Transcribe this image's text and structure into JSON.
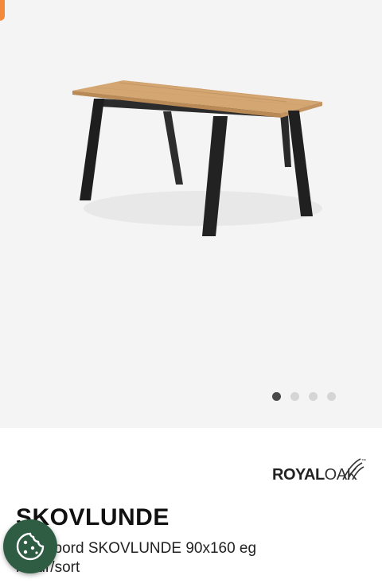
{
  "product": {
    "brand_royal": "ROYAL",
    "brand_oak": "OAK",
    "brand_trademark": "™",
    "name": "SKOVLUNDE",
    "description": "Spisebord SKOVLUNDE 90x160 eg natur/sort"
  },
  "gallery": {
    "image_count": 4,
    "active_index": 0
  },
  "colors": {
    "accent_tab": "#f28a3a",
    "cookie_button": "#2f5d44"
  },
  "icons": {
    "cookie": "cookie-icon"
  }
}
